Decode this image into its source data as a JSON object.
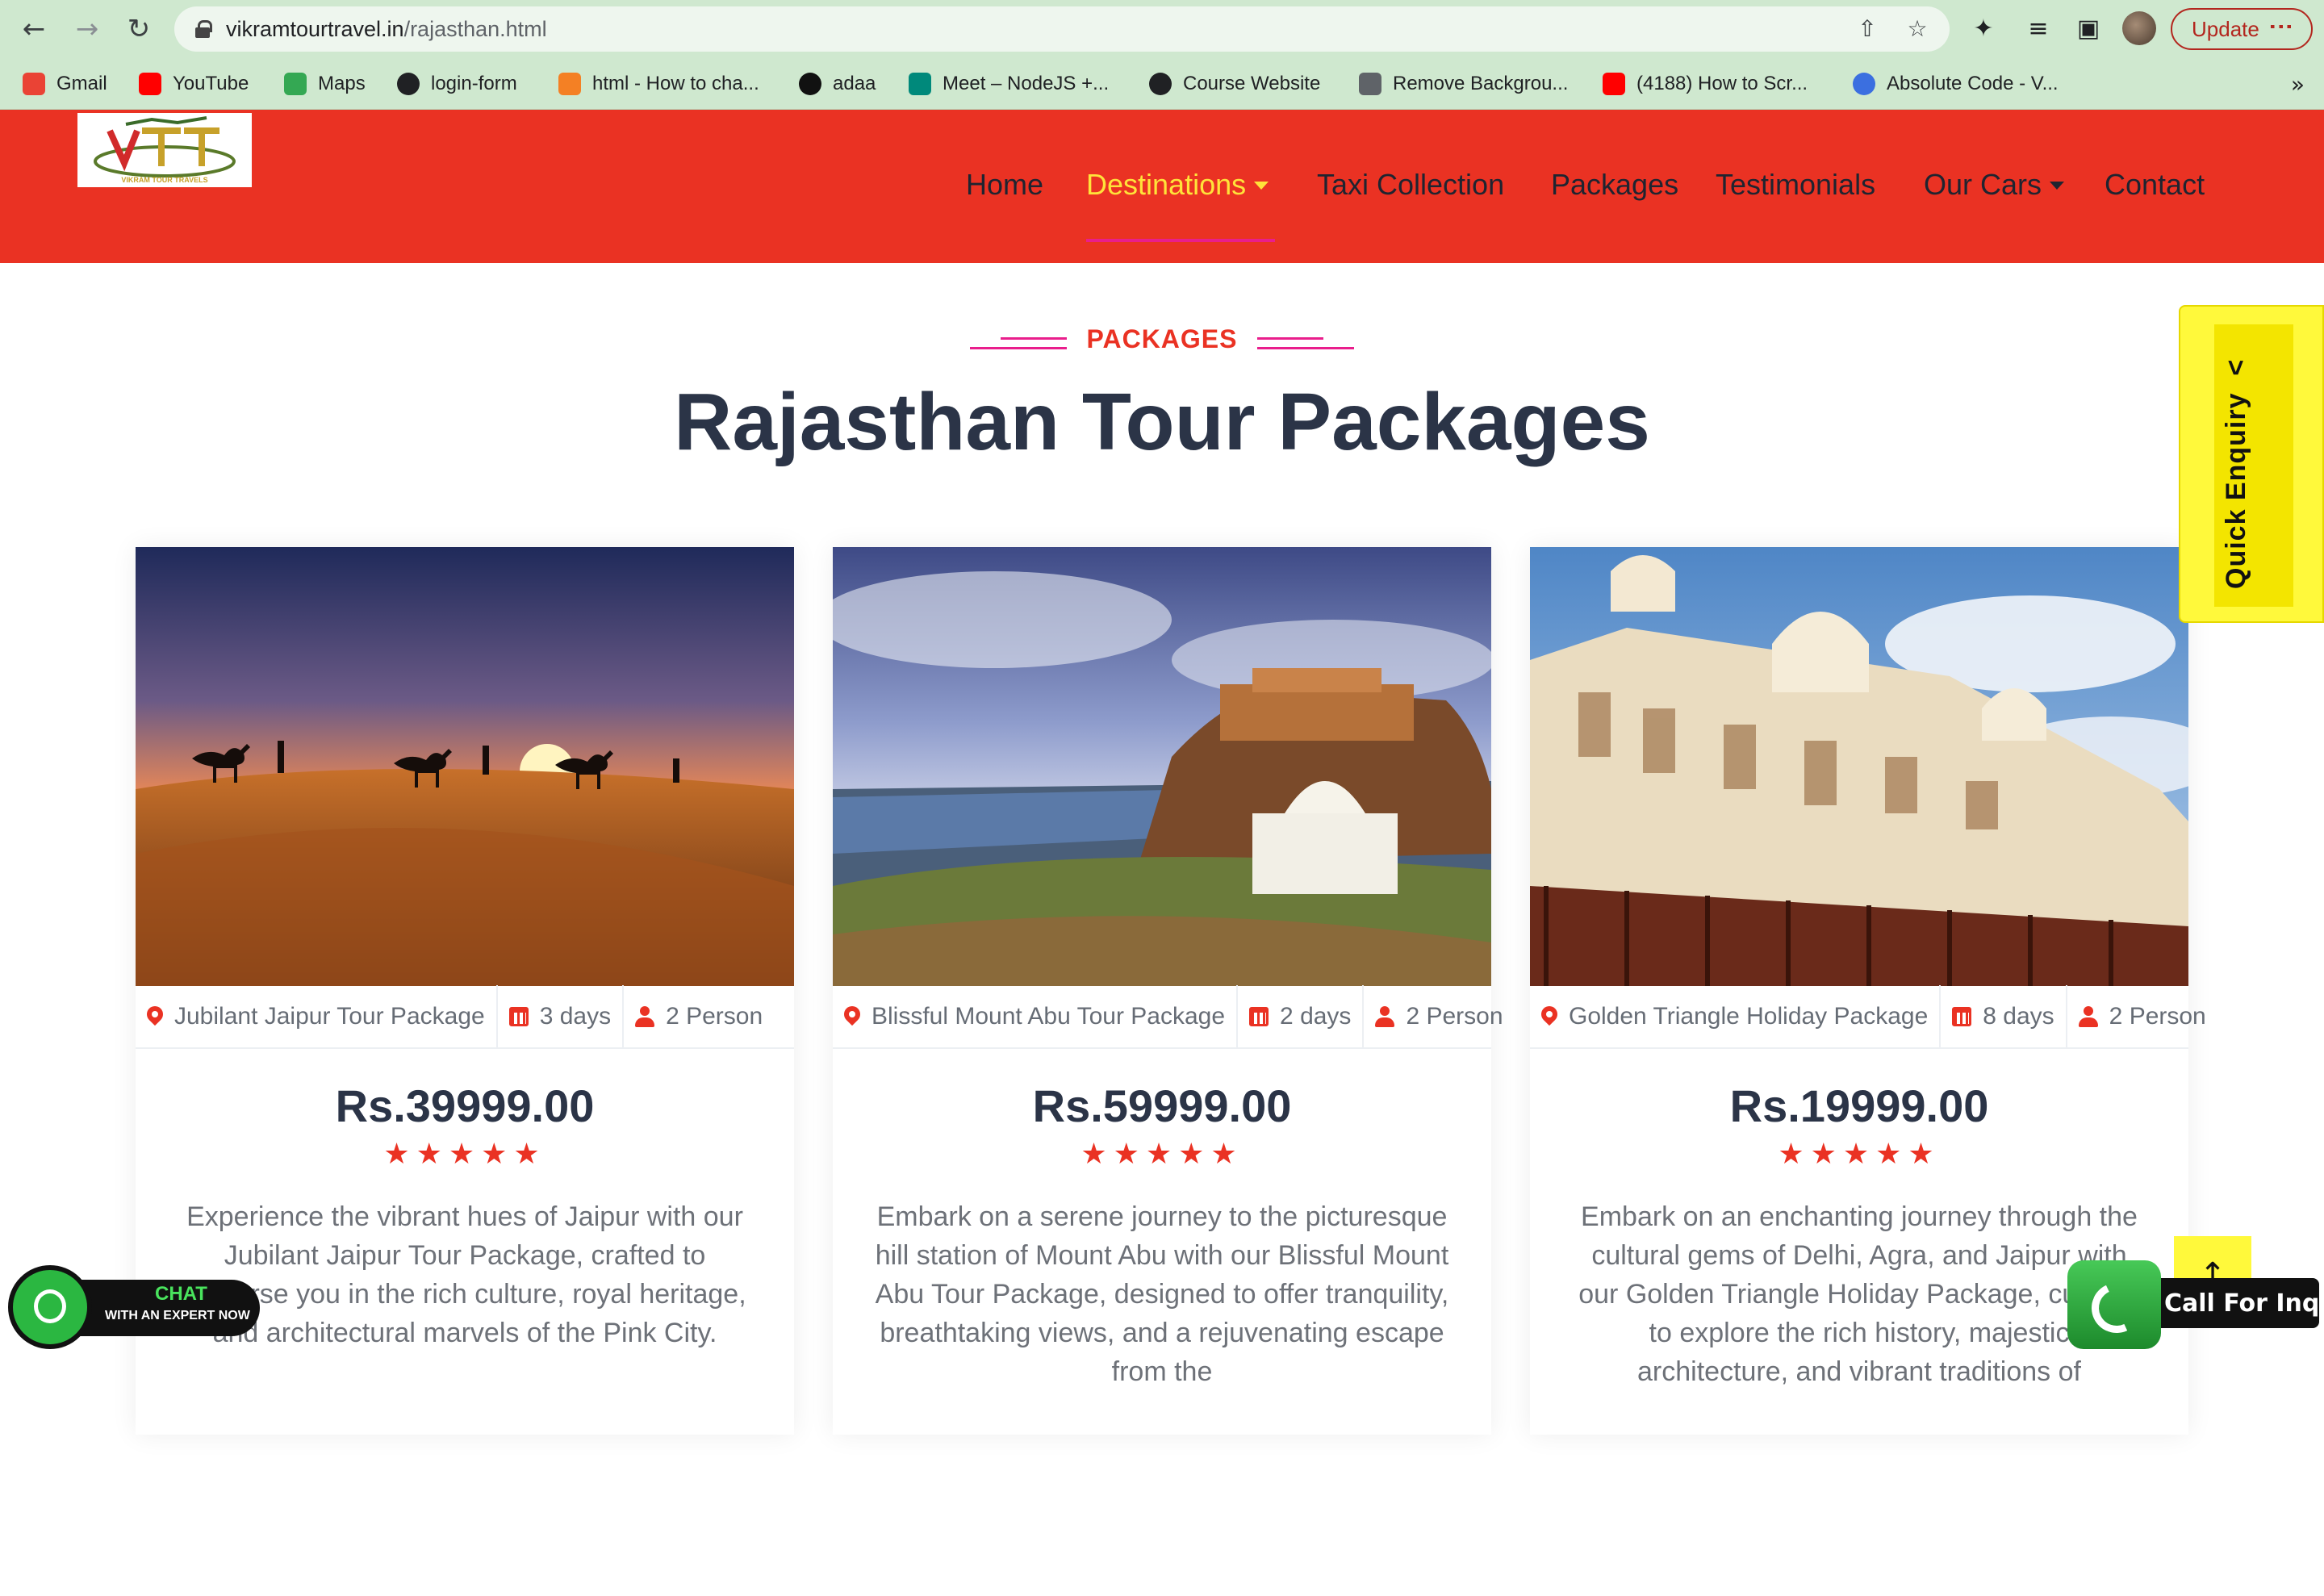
{
  "browser": {
    "url_domain": "vikramtourtravel.in",
    "url_path": "/rajasthan.html",
    "update_label": "Update",
    "icons": [
      "back-arrow-icon",
      "forward-arrow-icon",
      "reload-icon",
      "lock-icon",
      "share-icon",
      "bookmark-star-icon",
      "extensions-icon",
      "reading-list-icon",
      "side-panel-icon",
      "profile-avatar-icon",
      "more-menu-icon"
    ]
  },
  "bookmarks": [
    {
      "label": "Gmail",
      "color": "#ea4335"
    },
    {
      "label": "YouTube",
      "color": "#ff0000"
    },
    {
      "label": "Maps",
      "color": "#34a853"
    },
    {
      "label": "login-form",
      "color": "#202124"
    },
    {
      "label": "html - How to cha...",
      "color": "#f48024"
    },
    {
      "label": "adaa",
      "color": "#111111"
    },
    {
      "label": "Meet – NodeJS +...",
      "color": "#00897b"
    },
    {
      "label": "Course Website",
      "color": "#202124"
    },
    {
      "label": "Remove Backgrou...",
      "color": "#5f6368"
    },
    {
      "label": "(4188) How to Scr...",
      "color": "#ff0000"
    },
    {
      "label": "Absolute Code - V...",
      "color": "#3b6fe0"
    }
  ],
  "bookmarks_more": "»",
  "site": {
    "logo_text": "VIKRAM TOUR TRAVELS",
    "logo_initials": "VTT",
    "nav": [
      {
        "label": "Home",
        "active": false,
        "dropdown": false
      },
      {
        "label": "Destinations",
        "active": true,
        "dropdown": true
      },
      {
        "label": "Taxi Collection",
        "active": false,
        "dropdown": false
      },
      {
        "label": "Packages",
        "active": false,
        "dropdown": false
      },
      {
        "label": "Testimonials",
        "active": false,
        "dropdown": false
      },
      {
        "label": "Our Cars",
        "active": false,
        "dropdown": true
      },
      {
        "label": "Contact",
        "active": false,
        "dropdown": false
      }
    ],
    "colors": {
      "header": "#ea3223",
      "active_nav": "#ffe33a",
      "accent_line": "#e91e8c",
      "title": "#2b3447"
    }
  },
  "section": {
    "eyebrow": "PACKAGES",
    "title": "Rajasthan Tour Packages"
  },
  "packages": [
    {
      "name": "Jubilant Jaipur Tour Package",
      "duration": "3 days",
      "persons": "2 Person",
      "price": "Rs.39999.00",
      "stars": "★★★★★",
      "rating": 5,
      "image": "desert-camels-sunset",
      "description": "Experience the vibrant hues of Jaipur with our Jubilant Jaipur Tour Package, crafted to immerse you in the rich culture, royal heritage, and architectural marvels of the Pink City."
    },
    {
      "name": "Blissful Mount Abu Tour Package",
      "duration": "2 days",
      "persons": "2 Person",
      "price": "Rs.59999.00",
      "stars": "★★★★★",
      "rating": 5,
      "image": "hill-fort-blue-city",
      "description": "Embark on a serene journey to the picturesque hill station of Mount Abu with our Blissful Mount Abu Tour Package, designed to offer tranquility, breathtaking views, and a rejuvenating escape from the"
    },
    {
      "name": "Golden Triangle Holiday Package",
      "duration": "8 days",
      "persons": "2 Person",
      "price": "Rs.19999.00",
      "stars": "★★★★★",
      "rating": 5,
      "image": "white-marble-palace",
      "description": "Embark on an enchanting journey through the cultural gems of Delhi, Agra, and Jaipur with our Golden Triangle Holiday Package, curated to explore the rich history, majestic architecture, and vibrant traditions of"
    }
  ],
  "widgets": {
    "quick_enquiry": "Quick Enquiry",
    "quick_enquiry_chevron": "<",
    "chat_line1": "CHAT",
    "chat_line2": "WITH AN EXPERT NOW",
    "to_top": "↑",
    "call_label": "Call For Inquiry"
  }
}
